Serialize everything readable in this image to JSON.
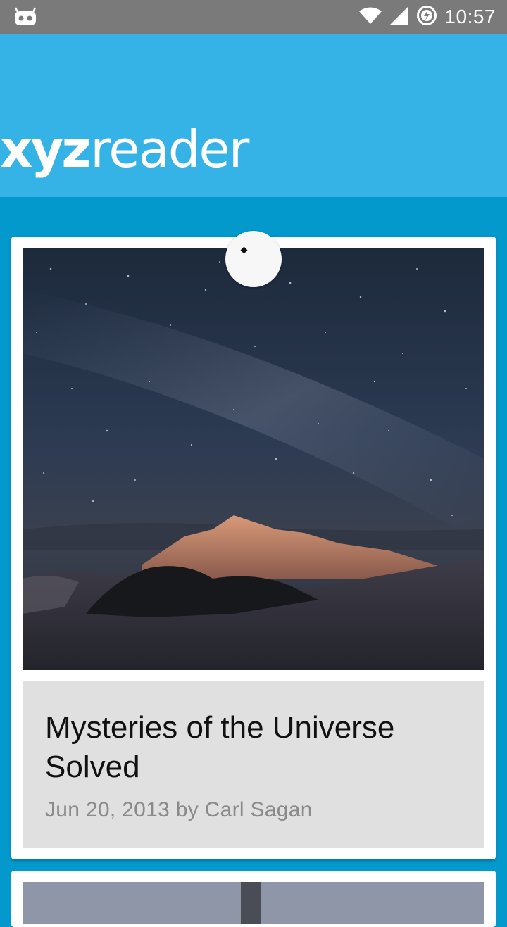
{
  "status_bar": {
    "time": "10:57",
    "left_icon": "cyanogen-bot-icon",
    "icons": [
      "wifi-icon",
      "cell-signal-icon",
      "battery-charging-icon"
    ]
  },
  "app_bar": {
    "logo_strong": "xyz",
    "logo_light": "reader",
    "background_color": "#35b3e6"
  },
  "articles": [
    {
      "title": "Mysteries of the Universe Solved",
      "meta": "Jun 20, 2013 by Carl Sagan",
      "image": "night-sky-mountain-image"
    },
    {
      "image": "tower-image"
    }
  ],
  "colors": {
    "content_background": "#0399cd",
    "status_bar": "#7a7a7a",
    "card_info_background": "#e0e0e0",
    "meta_text": "#8a8a8a"
  }
}
